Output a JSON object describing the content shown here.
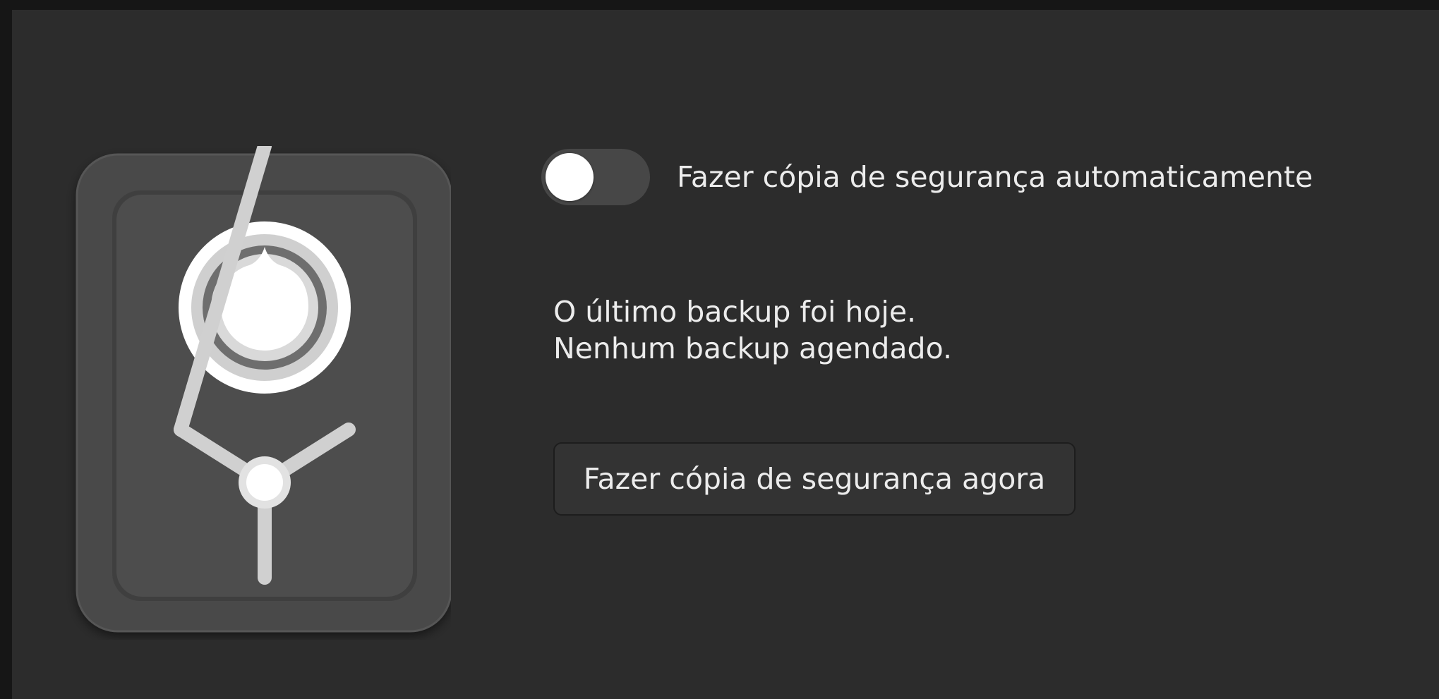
{
  "backup": {
    "auto_backup": {
      "label": "Fazer cópia de segurança automaticamente",
      "enabled": false
    },
    "status": {
      "last_backup": "O último backup foi hoje.",
      "next_backup": "Nenhum backup agendado."
    },
    "backup_now_label": "Fazer cópia de segurança agora"
  },
  "icons": {
    "hero": "vault-safe-icon"
  },
  "colors": {
    "window_background": "#2c2c2c",
    "frame_background": "#161616",
    "text": "#ececec",
    "switch_off": "#474747"
  }
}
